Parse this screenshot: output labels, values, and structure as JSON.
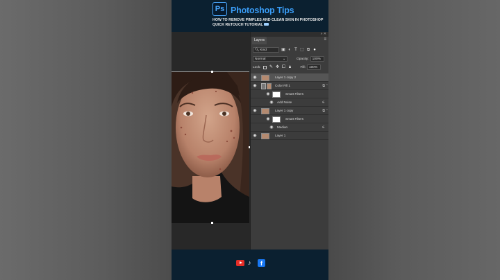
{
  "header": {
    "logo_text": "Ps",
    "title": "Photoshop Tips",
    "subtitle": "HOW TO REMOVE PIMPLES AND CLEAN SKIN IN PHOTOSHOP  QUICK RETOUCH TUTORIAL"
  },
  "panel": {
    "tab_label": "Layers",
    "filter_kind": "Kind",
    "blend_mode": "Normal",
    "opacity_label": "Opacity:",
    "opacity_value": "100%",
    "lock_label": "Lock:",
    "fill_label": "Fill:",
    "fill_value": "100%",
    "layers": [
      {
        "name": "Layer 1 copy 2",
        "selected": true
      },
      {
        "name": "Color Fill 1"
      },
      {
        "name": "Smart Filters"
      },
      {
        "name": "Add Noise"
      },
      {
        "name": "Layer 1 copy"
      },
      {
        "name": "Smart Filters"
      },
      {
        "name": "Median"
      },
      {
        "name": "Layer 1"
      }
    ]
  },
  "colors": {
    "brand_blue": "#3a9df7",
    "frame_bg": "#0b2030",
    "panel_bg": "#3c3c3c"
  },
  "icons": [
    "photoshop-logo",
    "youtube-icon",
    "tiktok-icon",
    "facebook-icon",
    "eye-icon",
    "search-icon",
    "menu-icon"
  ]
}
